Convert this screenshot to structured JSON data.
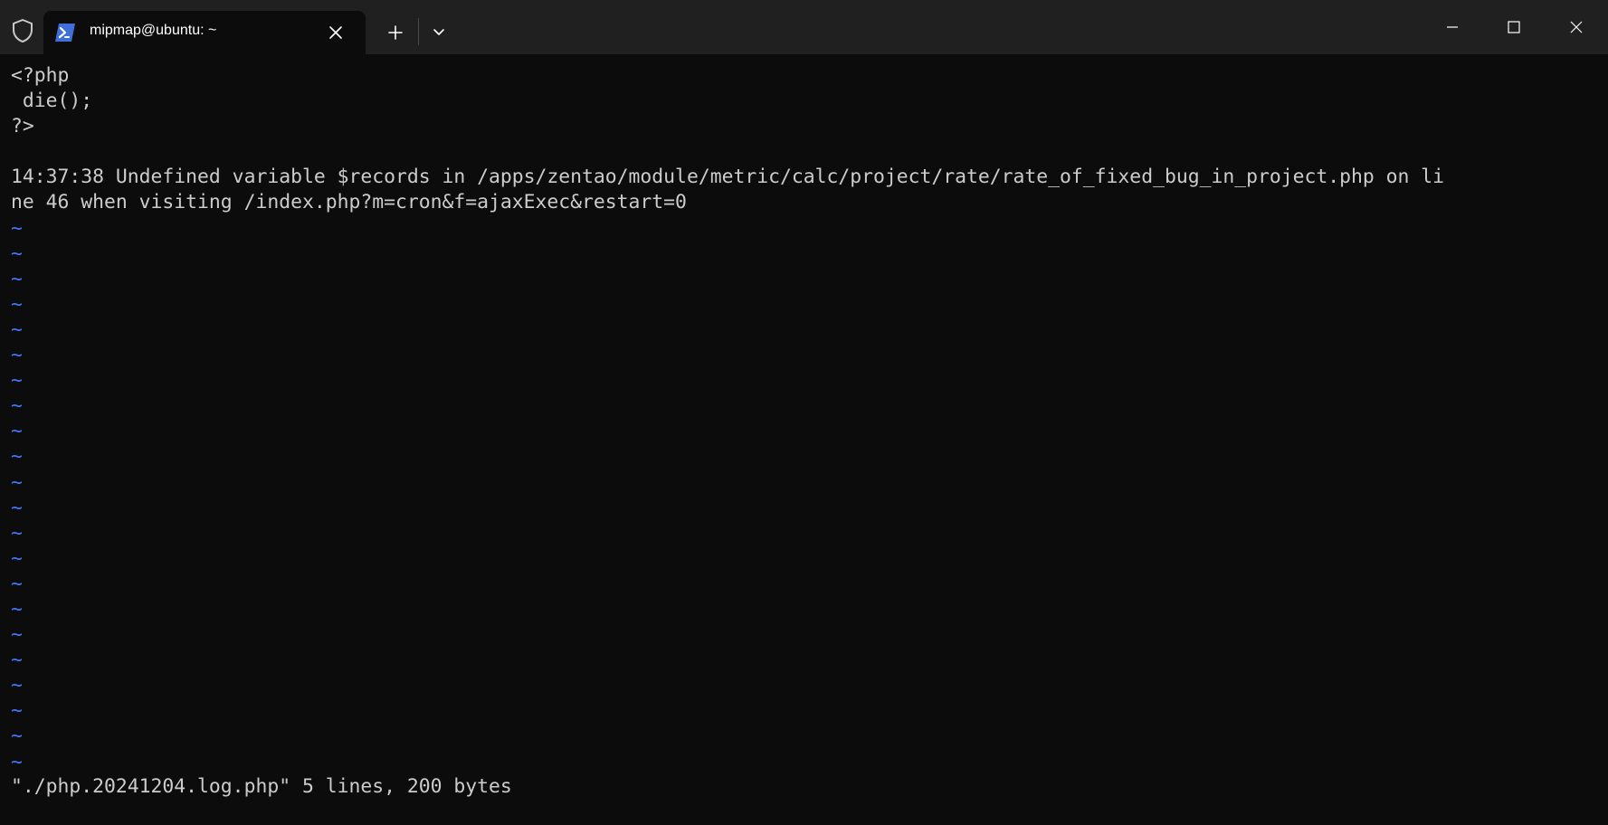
{
  "window": {
    "tab_title": "mipmap@ubuntu: ~",
    "new_tab_label": "+",
    "accent_color": "#3b78ff"
  },
  "terminal": {
    "lines": [
      "<?php",
      " die();",
      "?>",
      "",
      "14:37:38 Undefined variable $records in /apps/zentao/module/metric/calc/project/rate/rate_of_fixed_bug_in_project.php on li",
      "ne 46 when visiting /index.php?m=cron&f=ajaxExec&restart=0"
    ],
    "tilde_char": "~",
    "empty_line_count": 22,
    "status_line": "\"./php.20241204.log.php\" 5 lines, 200 bytes"
  },
  "icons": {
    "shield": "shield-icon",
    "tab_icon": "powershell-icon",
    "tab_close": "close-icon",
    "new_tab": "plus-icon",
    "dropdown": "chevron-down-icon",
    "minimize": "minimize-icon",
    "maximize": "maximize-icon",
    "close": "close-icon"
  }
}
